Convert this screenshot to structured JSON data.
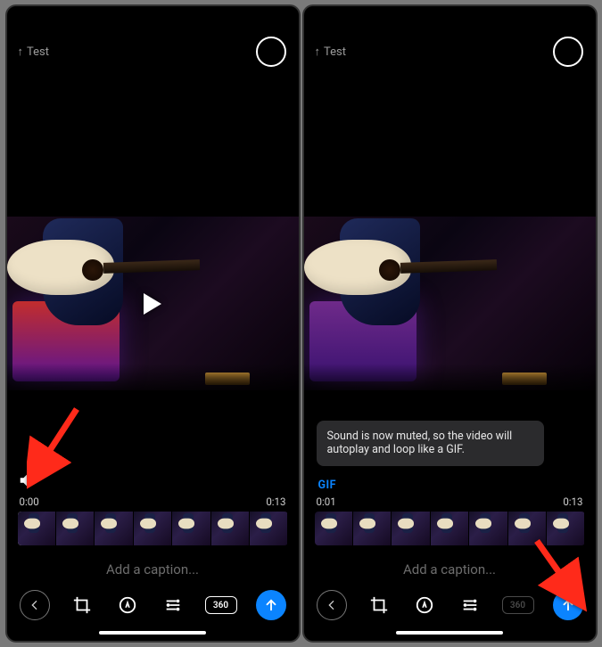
{
  "left": {
    "recipient": "Test",
    "time_start": "0:00",
    "time_end": "0:13",
    "caption_placeholder": "Add a caption...",
    "three_sixty_label": "360"
  },
  "right": {
    "recipient": "Test",
    "tooltip_text": "Sound is now muted, so the video will autoplay and loop like a GIF.",
    "gif_badge": "GIF",
    "time_start": "0:01",
    "time_end": "0:13",
    "caption_placeholder": "Add a caption...",
    "three_sixty_label": "360"
  },
  "colors": {
    "accent": "#0b84ff"
  }
}
